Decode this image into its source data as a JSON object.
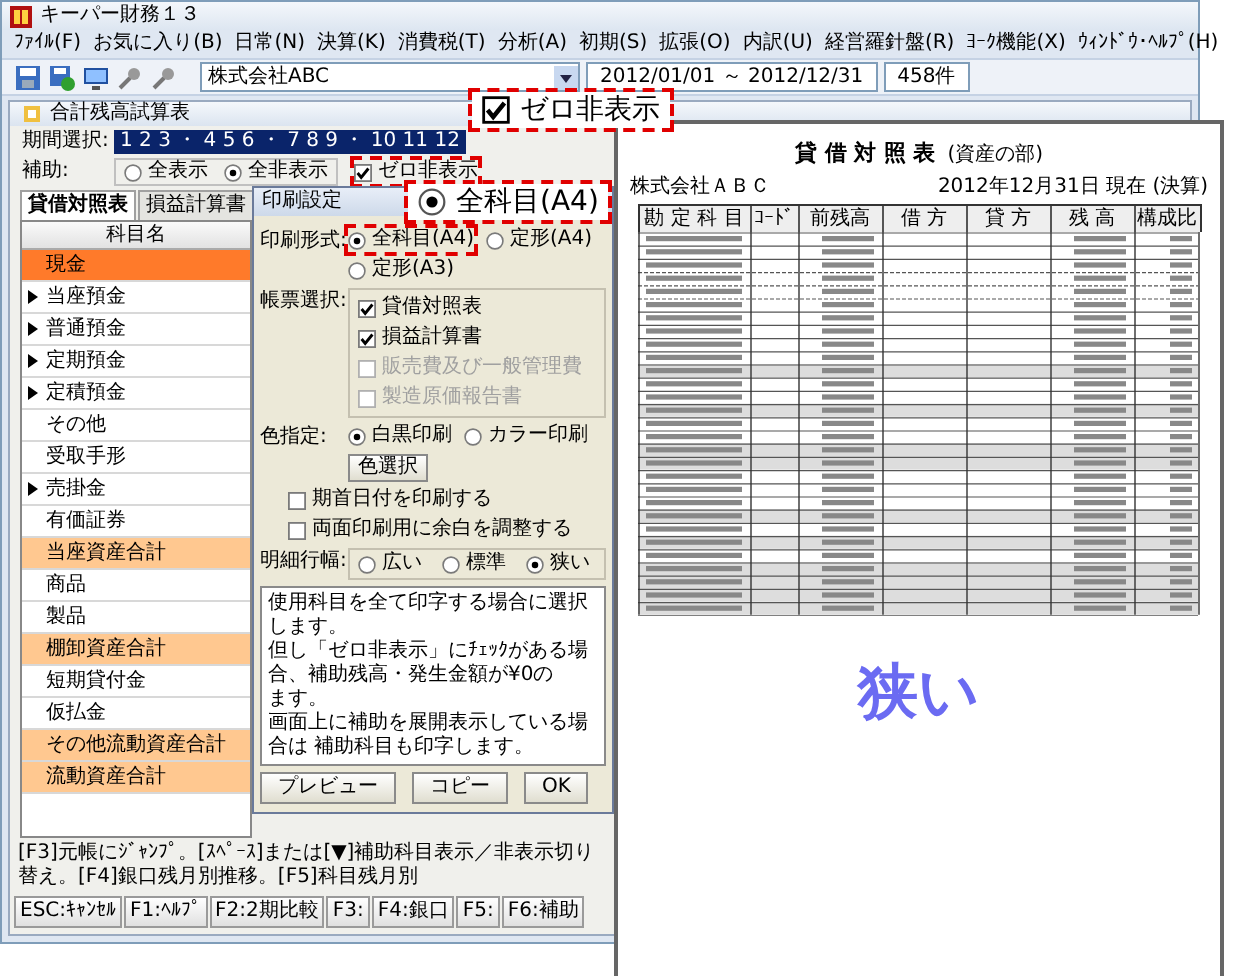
{
  "window": {
    "title": "キーパー財務１３"
  },
  "menu": [
    "ﾌｧｲﾙ(F)",
    "お気に入り(B)",
    "日常(N)",
    "決算(K)",
    "消費税(T)",
    "分析(A)",
    "初期(S)",
    "拡張(O)",
    "内訳(U)",
    "経営羅針盤(R)",
    "ﾖｰｸ機能(X)",
    "ｳｨﾝﾄﾞｳ･ﾍﾙﾌﾟ(H)"
  ],
  "toolbar": {
    "company": "株式会社ABC",
    "period": "2012/01/01 ～ 2012/12/31",
    "count": "458件"
  },
  "child": {
    "title": "合計残高試算表",
    "period_label": "期間選択:",
    "period_value": "1 2 3 ・ 4 5 6 ・ 7 8 9 ・ 10 11 12",
    "aux_label": "補助:",
    "aux_options": [
      {
        "label": "全表示",
        "selected": false
      },
      {
        "label": "全非表示",
        "selected": true
      }
    ],
    "zero_hide": {
      "label": "ゼロ非表示",
      "checked": true,
      "highlighted": true
    },
    "tabs": [
      {
        "label": "貸借対照表",
        "selected": true
      },
      {
        "label": "損益計算書",
        "selected": false
      }
    ],
    "column": "科目名",
    "rows": [
      {
        "name": "現金",
        "kind": "account",
        "expandable": false,
        "selected": true
      },
      {
        "name": "当座預金",
        "kind": "account",
        "expandable": true,
        "selected": false
      },
      {
        "name": "普通預金",
        "kind": "account",
        "expandable": true,
        "selected": false
      },
      {
        "name": "定期預金",
        "kind": "account",
        "expandable": true,
        "selected": false
      },
      {
        "name": "定積預金",
        "kind": "account",
        "expandable": true,
        "selected": false
      },
      {
        "name": "その他",
        "kind": "account",
        "expandable": false,
        "selected": false
      },
      {
        "name": "受取手形",
        "kind": "account",
        "expandable": false,
        "selected": false
      },
      {
        "name": "売掛金",
        "kind": "account",
        "expandable": true,
        "selected": false
      },
      {
        "name": "有価証券",
        "kind": "account",
        "expandable": false,
        "selected": false
      },
      {
        "name": "当座資産合計",
        "kind": "total",
        "expandable": false,
        "selected": false
      },
      {
        "name": "商品",
        "kind": "account",
        "expandable": false,
        "selected": false
      },
      {
        "name": "製品",
        "kind": "account",
        "expandable": false,
        "selected": false
      },
      {
        "name": "棚卸資産合計",
        "kind": "total",
        "expandable": false,
        "selected": false
      },
      {
        "name": "短期貸付金",
        "kind": "account",
        "expandable": false,
        "selected": false
      },
      {
        "name": "仮払金",
        "kind": "account",
        "expandable": false,
        "selected": false
      },
      {
        "name": "その他流動資産合計",
        "kind": "total",
        "expandable": false,
        "selected": false
      },
      {
        "name": "流動資産合計",
        "kind": "total",
        "expandable": false,
        "selected": false
      }
    ],
    "status": "[F3]元帳にｼﾞｬﾝﾌﾟ。[ｽﾍﾟｰｽ]または[▼]補助科目表示／非表示切り替え。[F4]銀口残月別推移。[F5]科目残月別",
    "function_keys": [
      "ESC:ｷｬﾝｾﾙ",
      "F1:ﾍﾙﾌﾟ",
      "F2:2期比較",
      "F3:",
      "F4:銀口",
      "F5:",
      "F6:補助"
    ]
  },
  "dialog": {
    "title": "印刷設定",
    "format_label": "印刷形式:",
    "formats": [
      {
        "label": "全科目(A4)",
        "selected": true,
        "highlighted": true
      },
      {
        "label": "定形(A4)",
        "selected": false,
        "highlighted": false
      },
      {
        "label": "定形(A3)",
        "selected": false,
        "highlighted": false
      }
    ],
    "report_label": "帳票選択:",
    "reports": [
      {
        "label": "貸借対照表",
        "checked": true,
        "disabled": false
      },
      {
        "label": "損益計算書",
        "checked": true,
        "disabled": false
      },
      {
        "label": "販売費及び一般管理費",
        "checked": false,
        "disabled": true
      },
      {
        "label": "製造原価報告書",
        "checked": false,
        "disabled": true
      }
    ],
    "color_label": "色指定:",
    "colors": [
      {
        "label": "白黒印刷",
        "selected": true
      },
      {
        "label": "カラー印刷",
        "selected": false
      }
    ],
    "color_button": "色選択",
    "options": [
      {
        "label": "期首日付を印刷する",
        "checked": false
      },
      {
        "label": "両面印刷用に余白を調整する",
        "checked": false
      }
    ],
    "width_label": "明細行幅:",
    "widths": [
      {
        "label": "広い",
        "selected": false
      },
      {
        "label": "標準",
        "selected": false
      },
      {
        "label": "狭い",
        "selected": true
      }
    ],
    "description": [
      "使用科目を全て印字する場合に選択します。",
      "但し「ゼロ非表示」にﾁｪｯｸがある場合、補助残高・発生金額が¥0の",
      "ます。",
      "画面上に補助を展開表示している場合は 補助科目も印字します。"
    ],
    "buttons": [
      "プレビュー",
      "コピー",
      "OK"
    ]
  },
  "callouts": [
    {
      "kind": "checkbox",
      "label": "ゼロ非表示",
      "checked": true
    },
    {
      "kind": "radio",
      "label": "全科目(A4)",
      "selected": true
    }
  ],
  "preview": {
    "title": "貸 借 対 照 表",
    "subtitle": "(資産の部)",
    "company": "株式会社ＡＢＣ",
    "date": "2012年12月31日 現在 (決算)",
    "columns": [
      "勘 定 科 目",
      "ｺｰﾄﾞ",
      "前残高",
      "借 方",
      "貸 方",
      "残 高",
      "構成比"
    ],
    "caption": "狭い"
  }
}
